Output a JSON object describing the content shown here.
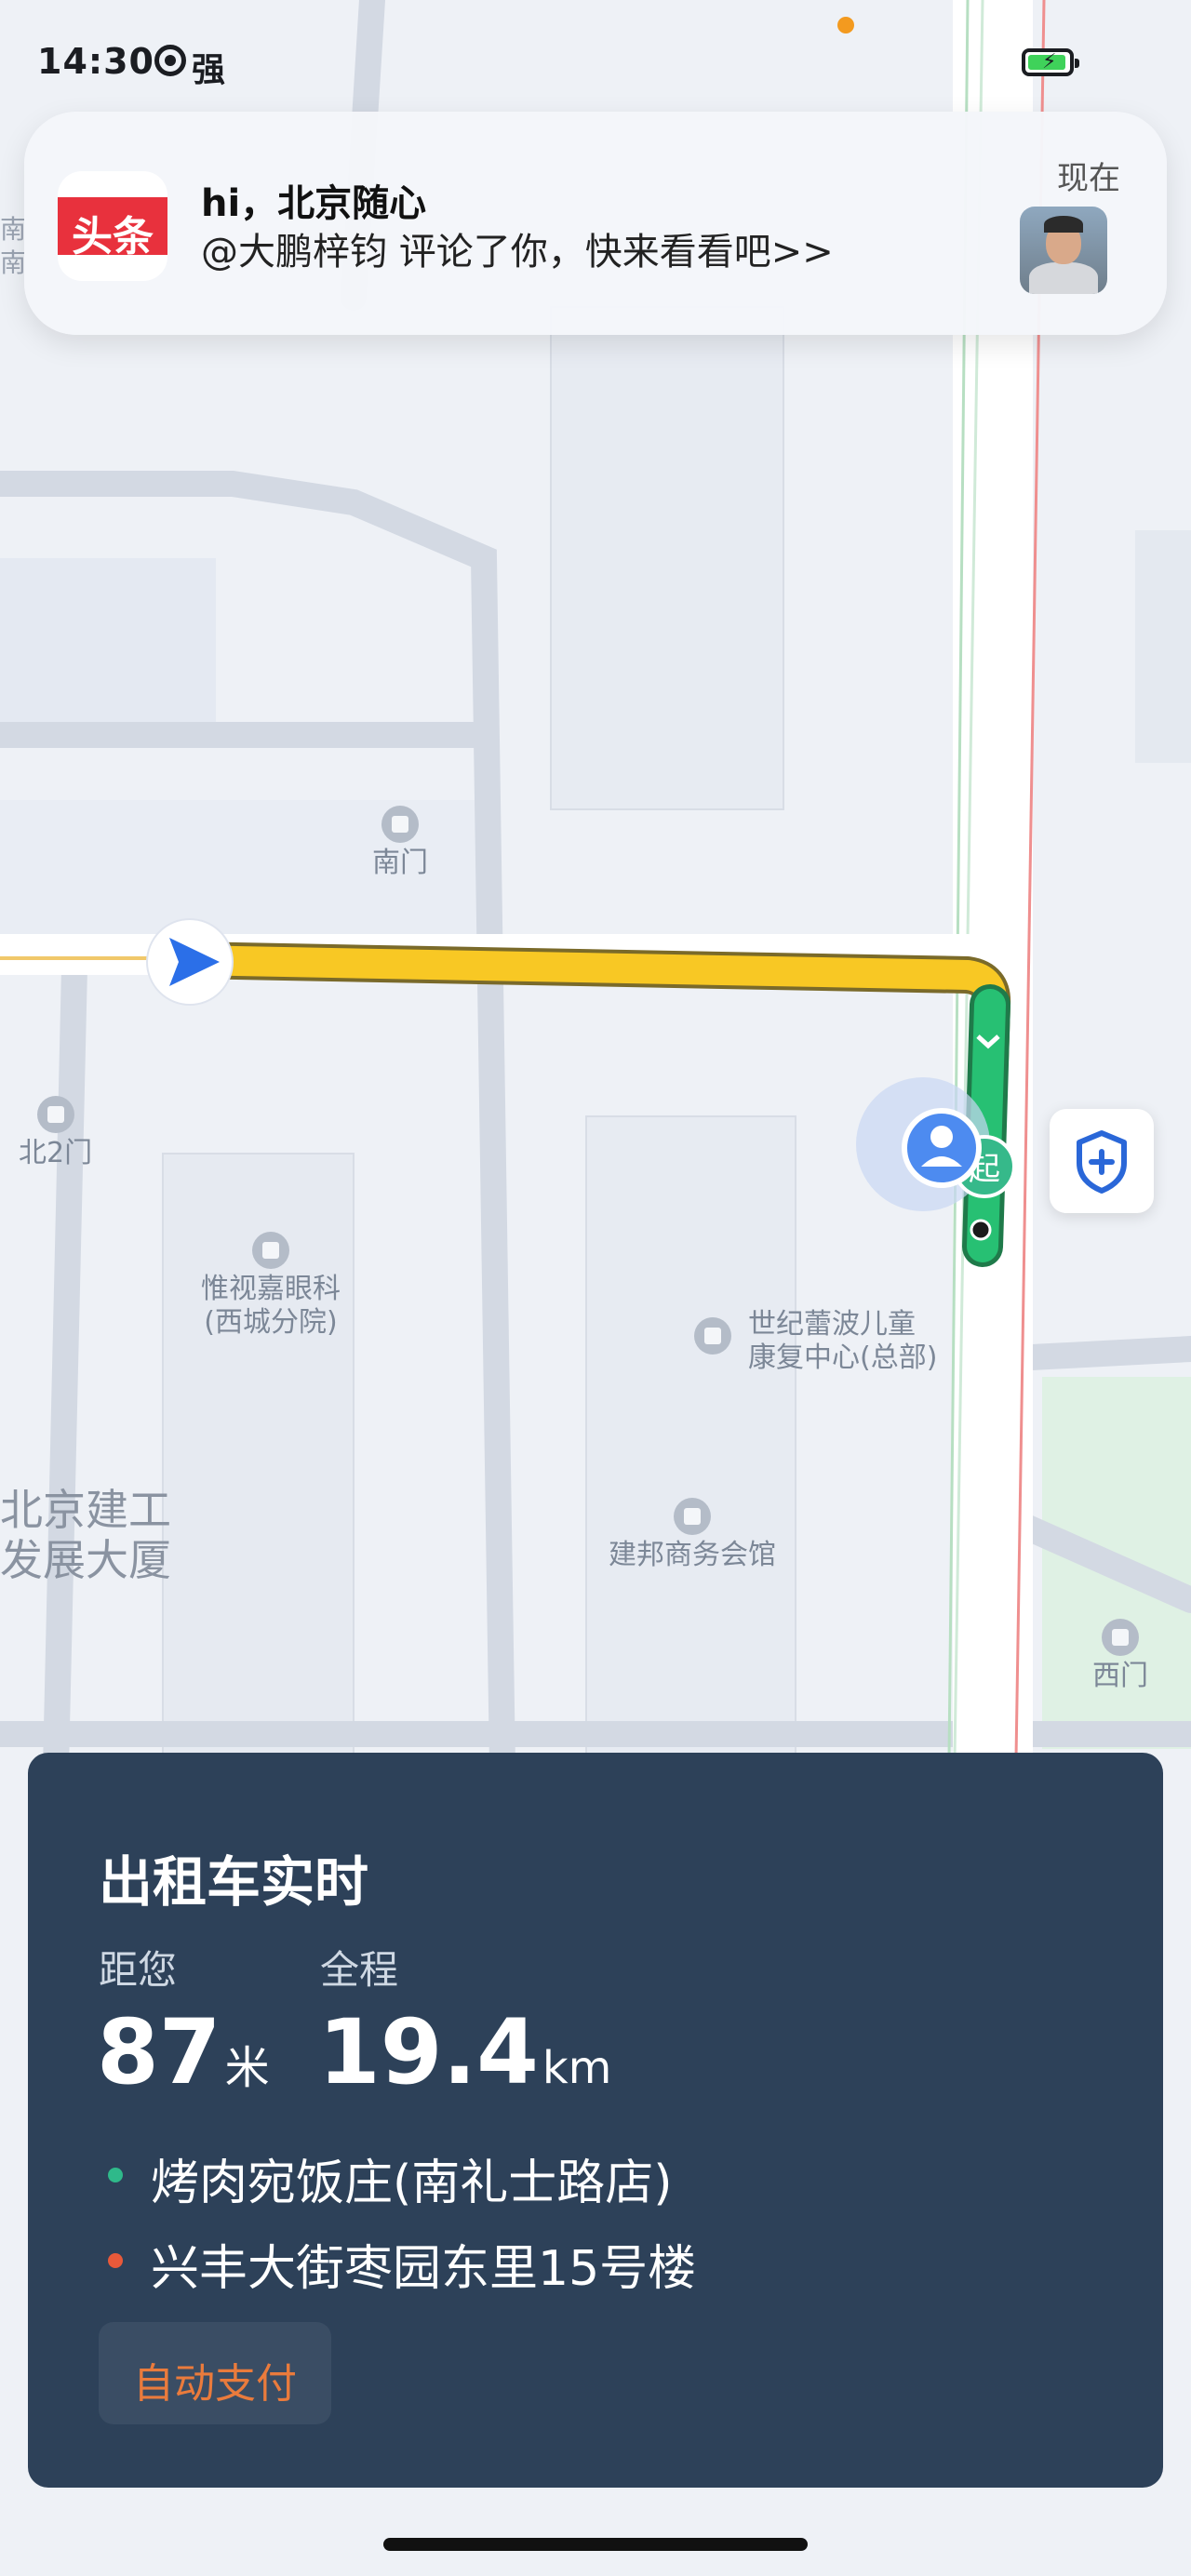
{
  "status_bar": {
    "time": "14:30",
    "signal_label": "强"
  },
  "notification": {
    "app": "头条",
    "title": "hi，北京随心",
    "body": "@大鹏梓钧 评论了你，快来看看吧>>",
    "time": "现在"
  },
  "map": {
    "pois": [
      {
        "name": "南门"
      },
      {
        "name": "北2门"
      },
      {
        "name": "惟视嘉眼科",
        "sub": "(西城分院)"
      },
      {
        "name": "世纪蕾波儿童",
        "sub": "康复中心(总部)"
      },
      {
        "name": "建邦商务会馆"
      },
      {
        "name": "西门"
      }
    ],
    "building_label": {
      "line1": "北京建工",
      "line2": "发展大厦"
    },
    "start_marker": "起",
    "edge_labels": {
      "left_top": "南",
      "left_bottom": "南"
    }
  },
  "trip_panel": {
    "title": "出租车实时",
    "distance_label": "距您",
    "distance_value": "87",
    "distance_unit": "米",
    "total_label": "全程",
    "total_value": "19.4",
    "total_unit": "km",
    "origin": "烤肉宛饭庄(南礼士路店)",
    "destination": "兴丰大街枣园东里15号楼",
    "pay_button": "自动支付",
    "colors": {
      "origin": "#2fb98a",
      "destination": "#e8593a"
    }
  }
}
